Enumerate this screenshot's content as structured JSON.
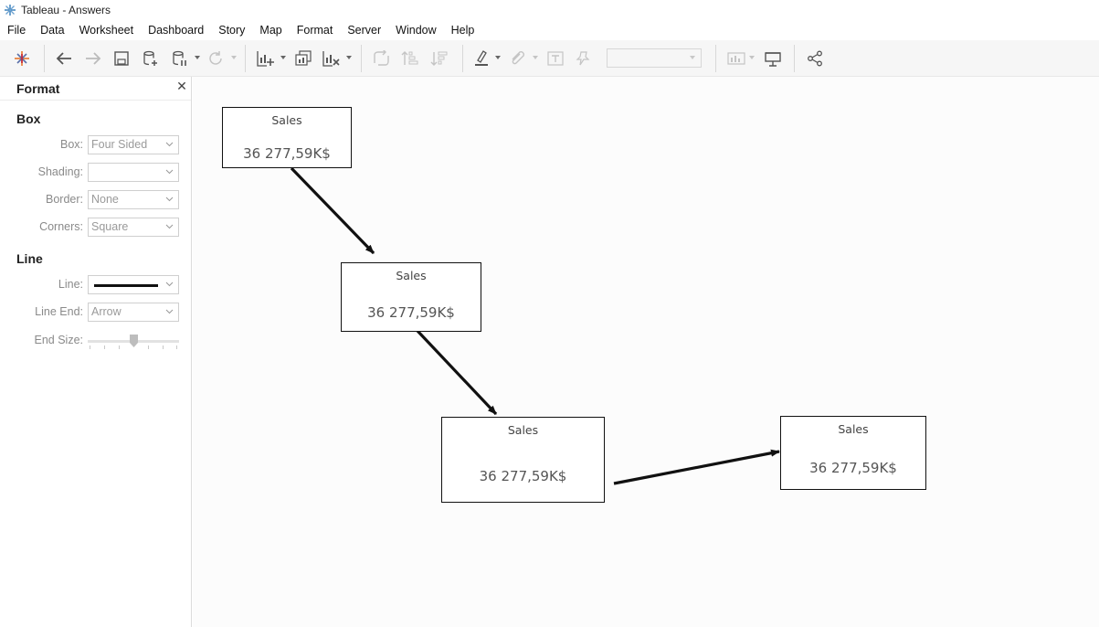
{
  "window": {
    "title": "Tableau - Answers",
    "app_icon": "tableau-logo-icon"
  },
  "menu": {
    "items": [
      {
        "label": "File"
      },
      {
        "label": "Data"
      },
      {
        "label": "Worksheet"
      },
      {
        "label": "Dashboard"
      },
      {
        "label": "Story"
      },
      {
        "label": "Map"
      },
      {
        "label": "Format"
      },
      {
        "label": "Server"
      },
      {
        "label": "Window"
      },
      {
        "label": "Help"
      }
    ]
  },
  "toolbar": {
    "icons": [
      "tableau-home-icon",
      "undo-icon",
      "redo-icon",
      "save-icon",
      "new-data-source-icon",
      "pause-auto-updates-icon",
      "refresh-icon",
      "new-worksheet-icon",
      "duplicate-sheet-icon",
      "clear-sheet-icon",
      "swap-rows-columns-icon",
      "sort-ascending-icon",
      "sort-descending-icon",
      "highlight-icon",
      "group-members-icon",
      "show-mark-labels-icon",
      "fix-axes-icon",
      "show-me-icon",
      "presentation-mode-icon",
      "share-icon"
    ],
    "fit_value": ""
  },
  "format_pane": {
    "title": "Format",
    "close_icon": "close-icon",
    "box_section": {
      "title": "Box",
      "fields": [
        {
          "label": "Box:",
          "value": "Four Sided"
        },
        {
          "label": "Shading:",
          "value": ""
        },
        {
          "label": "Border:",
          "value": "None"
        },
        {
          "label": "Corners:",
          "value": "Square"
        }
      ]
    },
    "line_section": {
      "title": "Line",
      "line_label": "Line:",
      "line_end_label": "Line End:",
      "line_end_value": "Arrow",
      "end_size_label": "End Size:",
      "end_size_level": 0.5
    }
  },
  "canvas": {
    "boxes": [
      {
        "label": "Sales",
        "value": "36 277,59K$"
      },
      {
        "label": "Sales",
        "value": "36 277,59K$"
      },
      {
        "label": "Sales",
        "value": "36 277,59K$"
      },
      {
        "label": "Sales",
        "value": "36 277,59K$"
      }
    ]
  }
}
